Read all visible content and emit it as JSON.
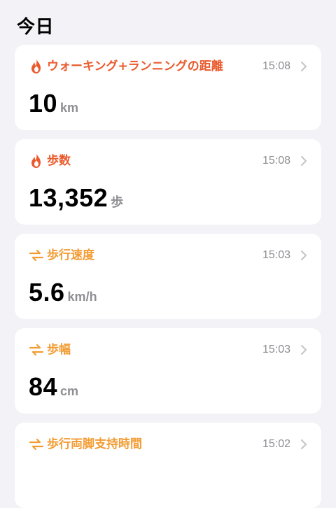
{
  "header": {
    "title": "今日"
  },
  "colors": {
    "activity": "#ea5a2d",
    "mobility": "#f39c34",
    "secondary_text": "#8e8e93",
    "background": "#f2f2f7"
  },
  "cards": [
    {
      "icon": "flame-icon",
      "title": "ウォーキング+ランニングの距離",
      "time": "15:08",
      "value": "10",
      "unit": "km"
    },
    {
      "icon": "flame-icon",
      "title": "歩数",
      "time": "15:08",
      "value": "13,352",
      "unit": "歩"
    },
    {
      "icon": "arrows-swap-icon",
      "title": "歩行速度",
      "time": "15:03",
      "value": "5.6",
      "unit": "km/h"
    },
    {
      "icon": "arrows-swap-icon",
      "title": "歩幅",
      "time": "15:03",
      "value": "84",
      "unit": "cm"
    },
    {
      "icon": "arrows-swap-icon",
      "title": "歩行両脚支持時間",
      "time": "15:02",
      "value": "",
      "unit": ""
    }
  ]
}
